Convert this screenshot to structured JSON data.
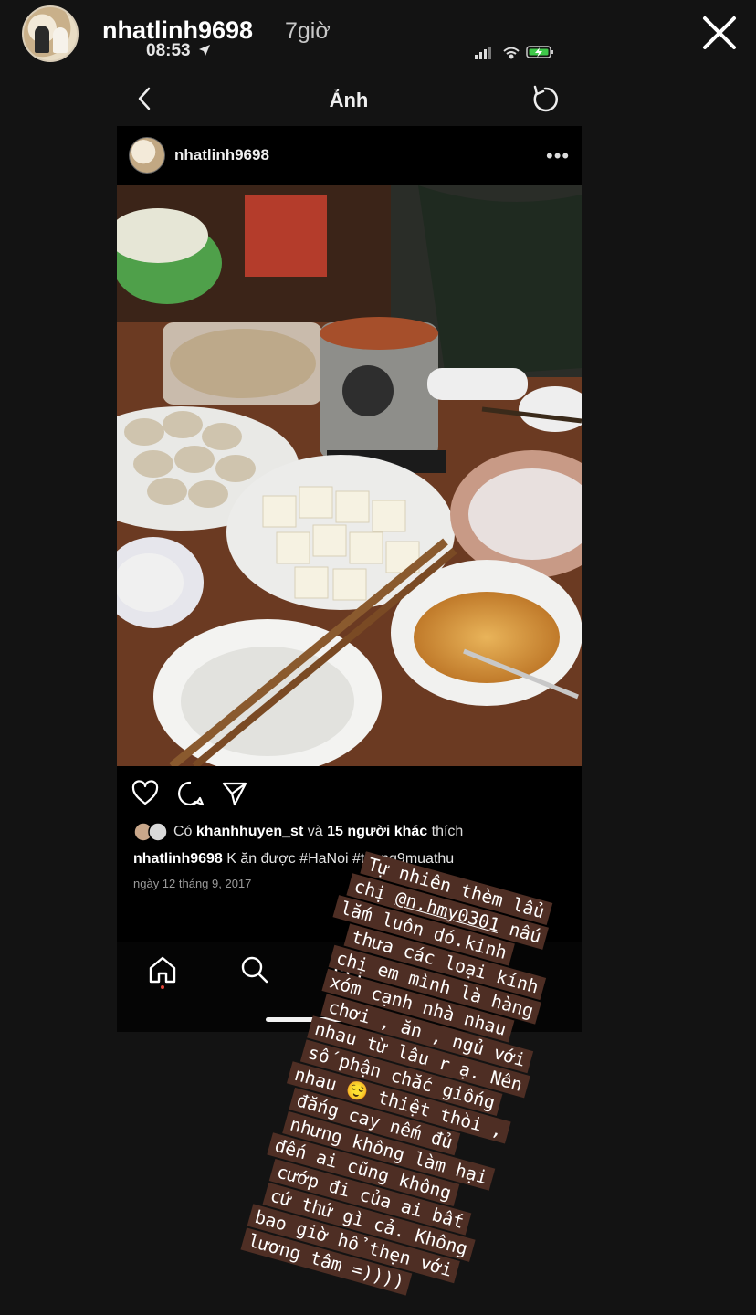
{
  "story": {
    "username": "nhatlinh9698",
    "time_ago": "7giờ",
    "close_icon": "close-icon"
  },
  "status_bar": {
    "time": "08:53",
    "location_icon": "location-arrow-icon",
    "signal_icon": "cellular-signal-icon",
    "wifi_icon": "wifi-icon",
    "battery_icon": "battery-charging-icon"
  },
  "nav": {
    "title": "Ảnh",
    "back_icon": "chevron-left-icon",
    "refresh_icon": "refresh-icon"
  },
  "post": {
    "username": "nhatlinh9698",
    "more_icon": "ellipsis-icon",
    "likes": {
      "prefix": "Có",
      "liker": "khanhhuyen_st",
      "conj": "và",
      "others": "15 người khác",
      "suffix": "thích"
    },
    "caption": {
      "author": "nhatlinh9698",
      "text": "K ăn được #HaNoi #thang9muathu"
    },
    "date": "ngày 12 tháng 9, 2017",
    "action_icons": [
      "heart-icon",
      "comment-icon",
      "share-icon"
    ]
  },
  "tabbar": {
    "icons": [
      "home-icon",
      "search-icon",
      "add-post-icon"
    ]
  },
  "sticker": {
    "lines": [
      "Tự nhiên thèm lẩu",
      "chị @n.hmy0301  nấu",
      "lắm luôn dó.kinh",
      "thưa các loại kính",
      "chị em mình là hàng",
      "xóm cạnh nhà nhau",
      "chơi , ăn , ngủ với",
      "nhau từ lâu r ạ. Nên",
      "số phận chắc giống",
      "nhau 😌 thiệt thòi ,",
      "đắng cay nếm đủ",
      "nhưng không làm hại",
      "đến ai cũng không",
      "cướp đi của ai bất",
      "cứ thứ gì cả. Không",
      "bao giờ hổ thẹn với",
      "lương tâm =))))"
    ],
    "mention": "@n.hmy0301",
    "background_color": "#4e2e24"
  }
}
